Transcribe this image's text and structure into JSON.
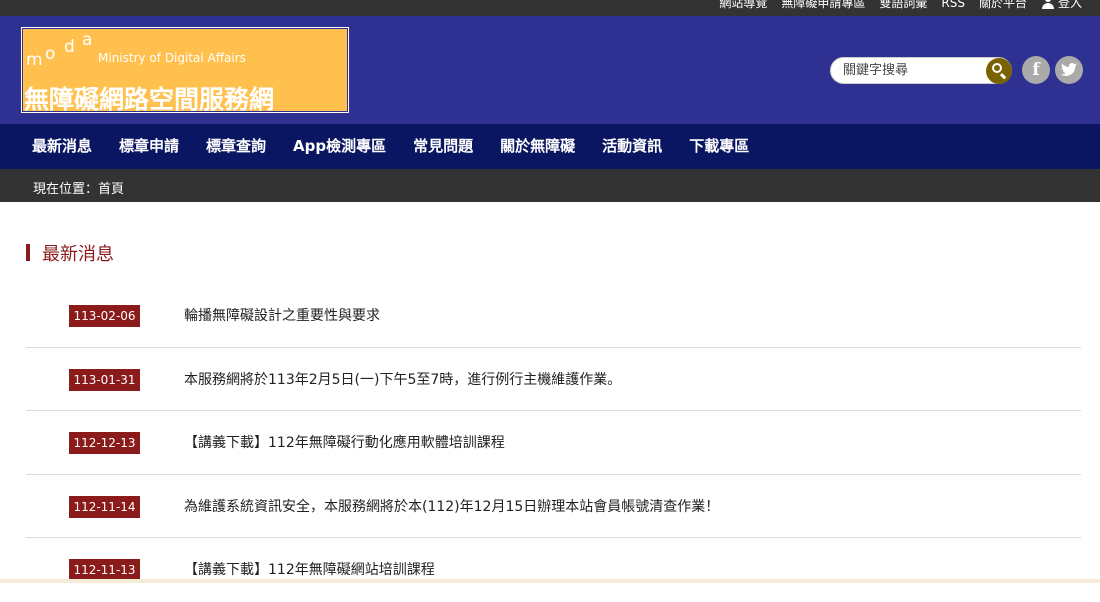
{
  "topbar": {
    "links": [
      "網站導覽",
      "無障礙申請專區",
      "雙語詞彙",
      "RSS",
      "關於平台"
    ],
    "login_label": "登入"
  },
  "header": {
    "logo_letters": [
      "m",
      "o",
      "d",
      "a"
    ],
    "logo_en": "Ministry of Digital Affairs",
    "logo_zh": "無障礙網路空間服務網",
    "search_placeholder": "關鍵字搜尋",
    "facebook_glyph": "f"
  },
  "nav": {
    "items": [
      "最新消息",
      "標章申請",
      "標章查詢",
      "App檢測專區",
      "常見問題",
      "關於無障礙",
      "活動資訊",
      "下載專區"
    ]
  },
  "breadcrumb": "現在位置：首頁",
  "news": {
    "title": "最新消息",
    "items": [
      {
        "date": "113-02-06",
        "title": "輪播無障礙設計之重要性與要求"
      },
      {
        "date": "113-01-31",
        "title": "本服務網將於113年2月5日(一)下午5至7時，進行例行主機維護作業。"
      },
      {
        "date": "112-12-13",
        "title": "【講義下載】112年無障礙行動化應用軟體培訓課程"
      },
      {
        "date": "112-11-14",
        "title": "為維護系統資訊安全，本服務網將於本(112)年12月15日辦理本站會員帳號清查作業！"
      },
      {
        "date": "112-11-13",
        "title": "【講義下載】112年無障礙網站培訓課程"
      }
    ]
  },
  "colors": {
    "header_bg": "#2e3192",
    "nav_bg": "#0b1662",
    "logo_bg": "#ffc04d",
    "accent": "#8b1a1a",
    "dark_bar": "#333333"
  }
}
